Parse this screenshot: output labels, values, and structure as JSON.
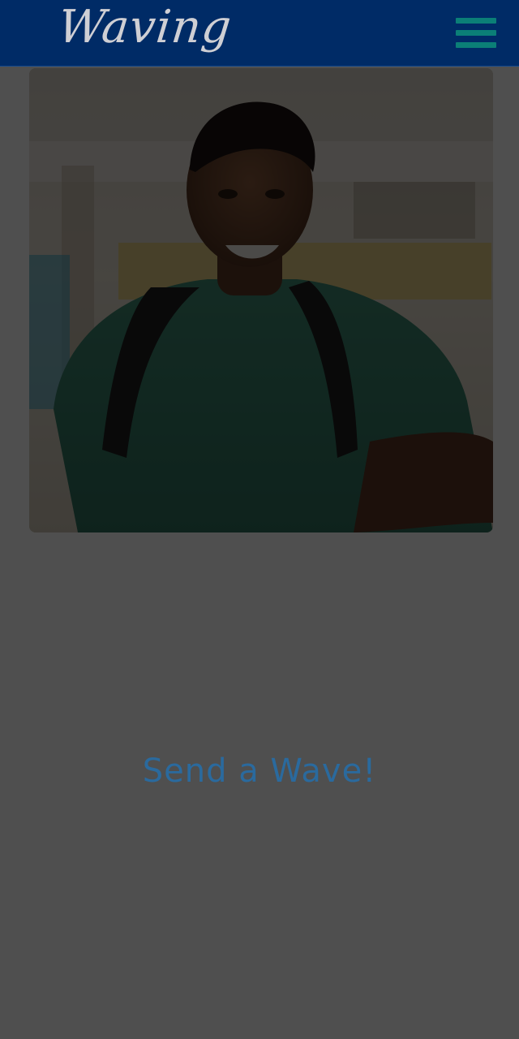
{
  "header": {
    "logo_text": "Waving",
    "menu_icon": "hamburger-menu-icon",
    "menu_color": "#0b7f77",
    "background_color": "#002b66"
  },
  "profile": {
    "photo_description_icon": "profile-photo"
  },
  "action": {
    "label": "Send a Wave!",
    "color": "#2a6a9e"
  },
  "overlay": {
    "dim_color": "#000000"
  }
}
